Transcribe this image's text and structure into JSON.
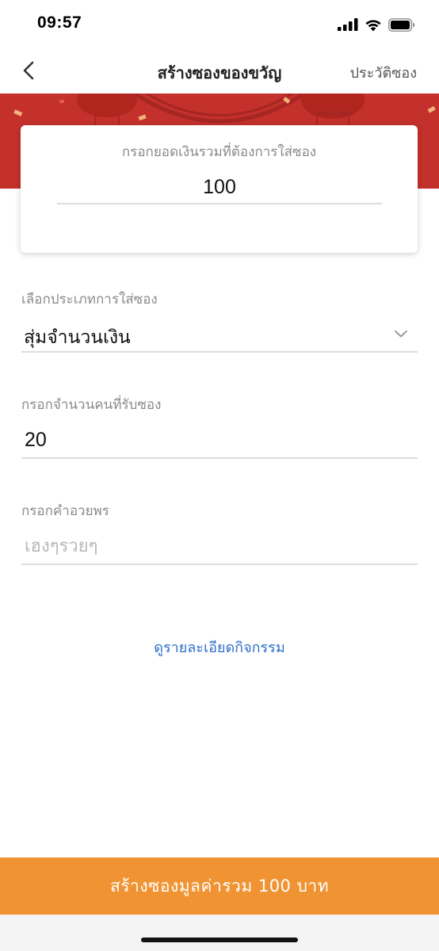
{
  "status": {
    "time": "09:57"
  },
  "nav": {
    "title": "สร้างซองของขวัญ",
    "history_label": "ประวัติซอง"
  },
  "amount_card": {
    "label": "กรอกยอดเงินรวมที่ต้องการใส่ซอง",
    "value": "100"
  },
  "envelope_type": {
    "label": "เลือกประเภทการใส่ซอง",
    "selected": "สุ่มจำนวนเงิน"
  },
  "recipients": {
    "label": "กรอกจำนวนคนที่รับซอง",
    "value": "20"
  },
  "wish": {
    "label": "กรอกคำอวยพร",
    "value": "",
    "placeholder": "เฮงๆรวยๆ"
  },
  "details_link": "ดูรายละเอียดกิจกรรม",
  "create_button": "สร้างซองมูลค่ารวม 100 บาท",
  "colors": {
    "banner_red": "#c4302b",
    "button_orange": "#f09433",
    "link_blue": "#2c6ecb"
  }
}
